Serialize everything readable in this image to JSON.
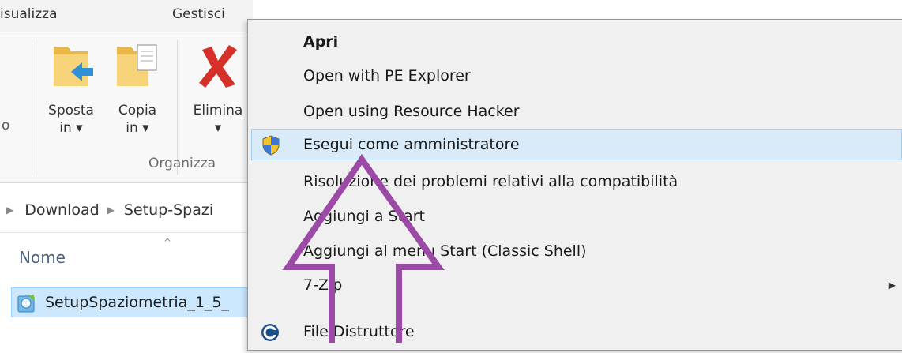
{
  "ribbon": {
    "tabs": [
      "isualizza",
      "Gestisci"
    ],
    "partial_label": "o",
    "buttons": [
      {
        "line1": "Sposta",
        "line2": "in ▾",
        "icon": "move-folder-icon"
      },
      {
        "line1": "Copia",
        "line2": "in ▾",
        "icon": "copy-folder-icon"
      },
      {
        "line1": "Elimina",
        "line2": "▾",
        "icon": "delete-x-icon"
      }
    ],
    "group_label": "Organizza"
  },
  "address_bar": {
    "crumbs": [
      "Download",
      "Setup-Spazi"
    ]
  },
  "file_list": {
    "column_header": "Nome",
    "selected_file": "SetupSpaziometria_1_5_"
  },
  "context_menu": {
    "items": [
      {
        "label": "Apri",
        "bold": true
      },
      {
        "label": "Open with PE Explorer"
      },
      {
        "label": "Open using Resource Hacker"
      },
      {
        "label": "Esegui come amministratore",
        "icon": "uac-shield-icon",
        "highlighted": true
      },
      {
        "label": "Risoluzione dei problemi relativi alla compatibilità"
      },
      {
        "label": "Aggiungi a Start"
      },
      {
        "label": "Aggiungi al menu Start (Classic Shell)"
      },
      {
        "label": "7-Zip",
        "submenu": true
      },
      {
        "label": "File Distruttore",
        "icon": "file-shredder-icon"
      }
    ]
  },
  "colors": {
    "highlight_bg": "#d9ebf9",
    "selection_bg": "#cce8ff",
    "annotation_arrow": "#9b4aa6"
  }
}
